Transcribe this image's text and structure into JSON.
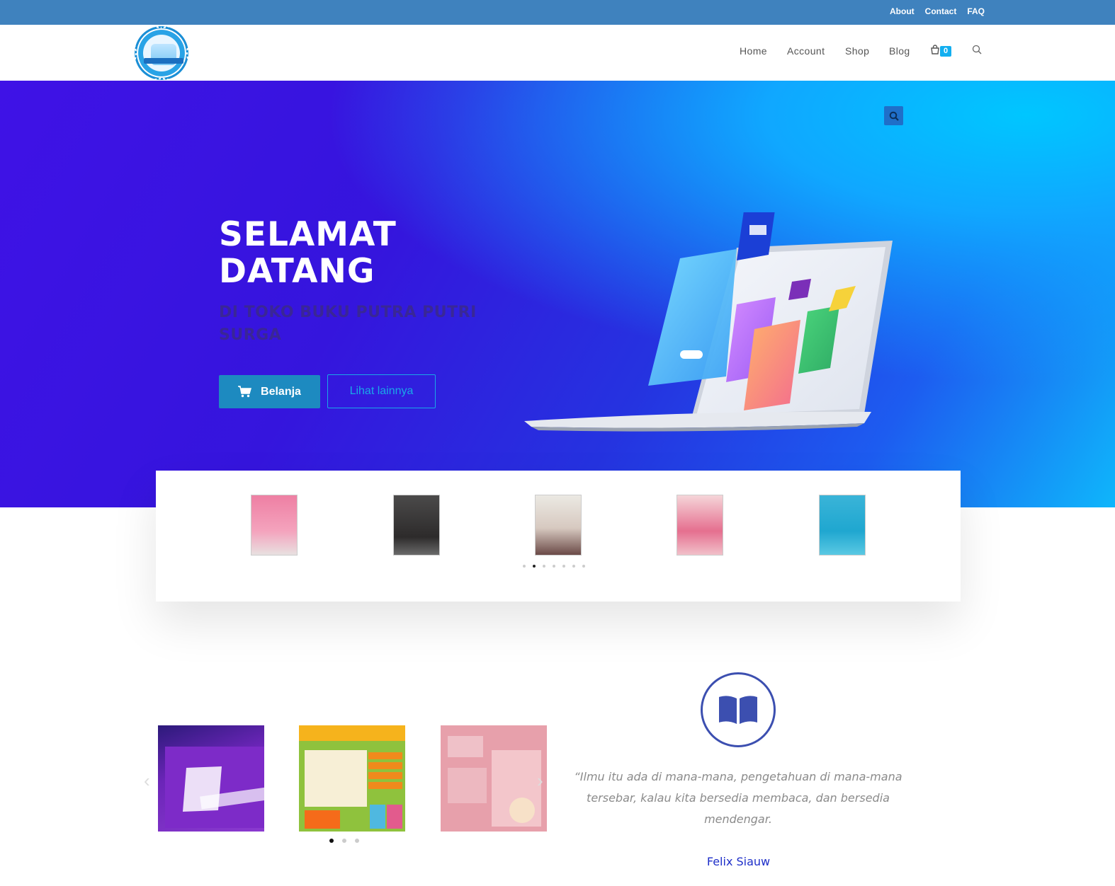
{
  "topbar": {
    "links": [
      "About",
      "Contact",
      "FAQ"
    ]
  },
  "header": {
    "nav": [
      "Home",
      "Account",
      "Shop",
      "Blog"
    ],
    "cart_count": "0"
  },
  "hero": {
    "title": "SELAMAT DATANG",
    "subtitle": "DI TOKO BUKU PUTRA PUTRI SURGA",
    "primary_button": "Belanja",
    "secondary_button": "Lihat lainnya"
  },
  "product_carousel": {
    "active_dot": 1,
    "dot_count": 7
  },
  "bottom_carousel": {
    "active_dot": 0,
    "dot_count": 3
  },
  "quote": {
    "text": "“Ilmu itu ada di mana-mana, pengetahuan di mana-mana tersebar, kalau kita bersedia membaca, dan bersedia mendengar.",
    "author": "Felix Siauw"
  },
  "colors": {
    "topbar": "#3f82be",
    "accent": "#13aff0",
    "button": "#1d8ac0",
    "author": "#1e2fc9"
  },
  "icons": [
    "cart-icon",
    "search-icon",
    "book-open-icon",
    "chevron-left-icon",
    "chevron-right-icon"
  ]
}
